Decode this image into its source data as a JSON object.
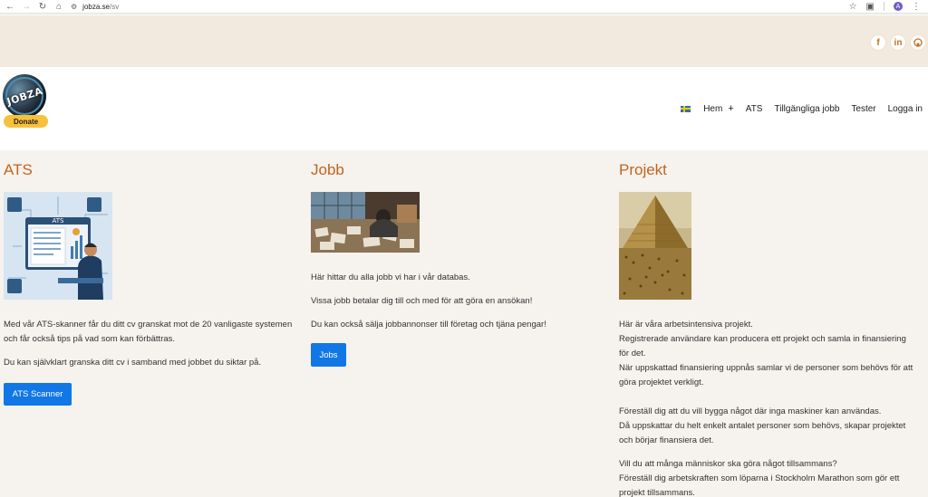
{
  "browser": {
    "url_host": "jobza.se",
    "url_path": "/sv",
    "profile_initial": "A"
  },
  "social": {
    "icons": [
      "facebook-icon",
      "linkedin-icon",
      "github-icon"
    ],
    "facebook_glyph": "f",
    "linkedin_glyph": "in",
    "github_glyph": "⚇"
  },
  "header": {
    "logo_text": "JOBZA",
    "donate_label": "Donate",
    "menu": {
      "home": "Hem",
      "plus": "+",
      "ats": "ATS",
      "jobs": "Tillgängliga jobb",
      "tests": "Tester",
      "login": "Logga in"
    }
  },
  "columns": {
    "ats": {
      "title": "ATS",
      "image_text": "ATS",
      "p1": "Med vår ATS-skanner får du ditt cv granskat mot de 20 vanligaste systemen och får också tips på vad som kan förbättras.",
      "p2": "Du kan självklart granska ditt cv i samband med jobbet du siktar på.",
      "button": "ATS Scanner"
    },
    "jobb": {
      "title": "Jobb",
      "p1": "Här hittar du alla jobb vi har i vår databas.",
      "p2": "Vissa jobb betalar dig till och med för att göra en ansökan!",
      "p3": "Du kan också sälja jobbannonser till företag och tjäna pengar!",
      "button": "Jobs"
    },
    "projekt": {
      "title": "Projekt",
      "p1_l1": "Här är våra arbetsintensiva projekt.",
      "p1_l2": "Registrerade användare kan producera ett projekt och samla in finansiering för det.",
      "p1_l3": "När uppskattad finansiering uppnås samlar vi de personer som behövs för att göra projektet verkligt.",
      "p2_l1": "Föreställ dig att du vill bygga något där inga maskiner kan användas.",
      "p2_l2": "Då uppskattar du helt enkelt antalet personer som behövs, skapar projektet och börjar finansiera det.",
      "p3_l1": "Vill du att många människor ska göra något tillsammans?",
      "p3_l2": "Föreställ dig arbetskraften som löparna i Stockholm Marathon som gör ett projekt tillsammans."
    }
  },
  "colors": {
    "accent": "#c0651a",
    "button": "#1177e6",
    "topband": "#f2e9df",
    "page_bg": "#f6f2ee"
  }
}
